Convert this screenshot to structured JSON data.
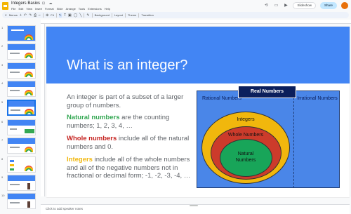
{
  "app": {
    "doc_title": "Integers Basics",
    "title_icons": "☆ ⊡ ☁",
    "menu": [
      "File",
      "Edit",
      "View",
      "Insert",
      "Format",
      "Slide",
      "Arrange",
      "Tools",
      "Extensions",
      "Help"
    ]
  },
  "header_right": {
    "slideshow_label": "Slideshow",
    "share_label": "Share"
  },
  "toolbar": {
    "menus_label": "Menus",
    "zoom": "Fit",
    "background_label": "Background",
    "layout_label": "Layout",
    "theme_label": "Theme",
    "transition_label": "Transition"
  },
  "filmstrip": {
    "numbers": [
      "1",
      "2",
      "3",
      "4",
      "5",
      "6",
      "7",
      "8",
      "9",
      "10"
    ],
    "selected_index": 4
  },
  "slide": {
    "title": "What is an integer?",
    "intro": "An integer is part of a subset of a larger group of numbers.",
    "natural_kw": "Natural numbers",
    "natural_rest": " are the counting numbers; 1, 2, 3, 4, …",
    "whole_kw": "Whole numbers",
    "whole_rest": " include all of the natural numbers and 0.",
    "integers_kw": "Integers",
    "integers_rest": " include all of the whole numbers and all of the negative numbers not in fractional or decimal form; -1, -2, -3, -4, …"
  },
  "diagram": {
    "real_label": "Real Numbers",
    "rational_label": "Rational Numbers",
    "irrational_label": "Irrational Numbers",
    "integers_label": "Integers",
    "whole_label": "Whole Numbers",
    "natural_label": "Natural Numbers"
  },
  "notes": {
    "placeholder": "Click to add speaker notes"
  },
  "colors": {
    "banner": "#4285f4",
    "natural_kw": "#34a853",
    "whole_kw": "#c5221f",
    "integers_kw": "#f1b70d"
  }
}
